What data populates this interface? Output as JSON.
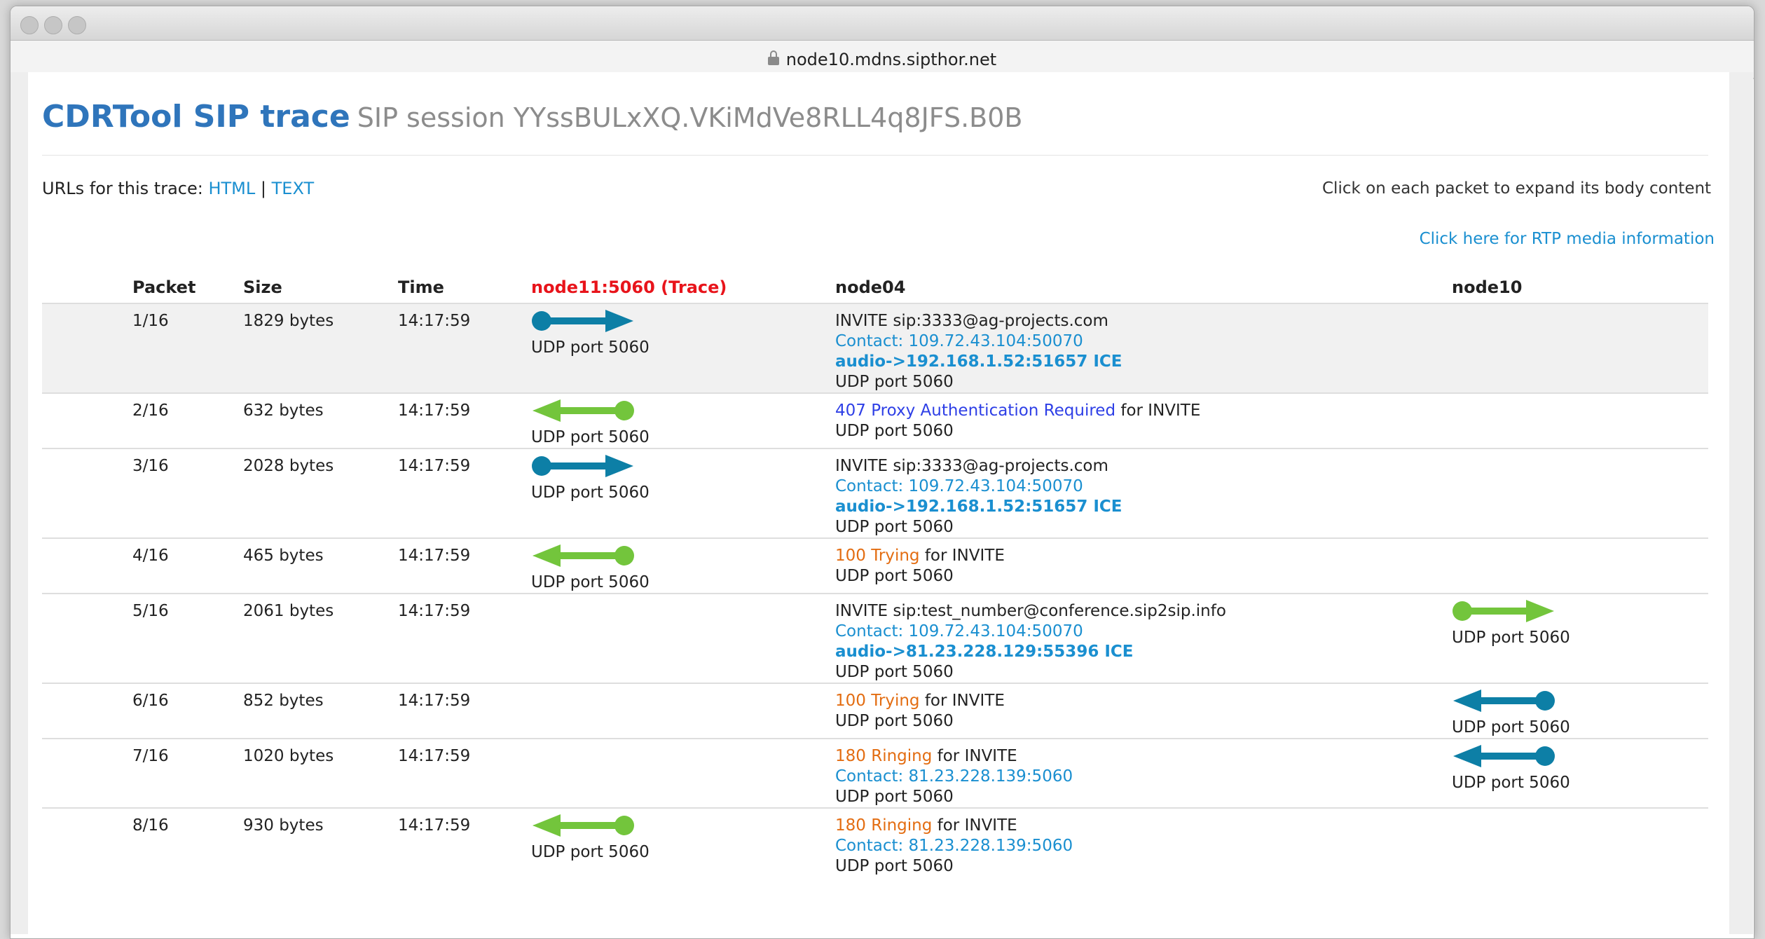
{
  "browser": {
    "url": "node10.mdns.sipthor.net"
  },
  "page": {
    "title_brand": "CDRTool SIP trace",
    "title_session": "SIP session YYssBULxXQ.VKiMdVe8RLL4q8JFS.B0B",
    "urls_label": "URLs for this trace:",
    "url_html": "HTML",
    "url_sep": "|",
    "url_text": "TEXT",
    "help_text": "Click on each packet to expand its body content",
    "rtp_link": "Click here for RTP media information"
  },
  "table": {
    "headers": {
      "packet": "Packet",
      "size": "Size",
      "time": "Time",
      "trace_node": "node11:5060 (Trace)",
      "mid_node": "node04",
      "right_node": "node10"
    },
    "rows": [
      {
        "packet": "1/16",
        "size": "1829 bytes",
        "time": "14:17:59",
        "tone": "normal",
        "left_arrow": {
          "dir": "right",
          "color": "#0d7fa6",
          "port": "UDP port 5060"
        },
        "right_arrow": null,
        "method": "INVITE sip:3333@ag-projects.com",
        "status_text": "",
        "status_suffix": "",
        "contact": "Contact: 109.72.43.104:50070",
        "audio": "audio->192.168.1.52:51657 ICE",
        "via": "UDP port 5060"
      },
      {
        "packet": "2/16",
        "size": "632 bytes",
        "time": "14:17:59",
        "tone": "blue",
        "left_arrow": {
          "dir": "left",
          "color": "#73c53c",
          "port": "UDP port 5060"
        },
        "right_arrow": null,
        "method": "",
        "status_text": "407 Proxy Authentication Required",
        "status_suffix": "for INVITE",
        "contact": "",
        "audio": "",
        "via": "UDP port 5060"
      },
      {
        "packet": "3/16",
        "size": "2028 bytes",
        "time": "14:17:59",
        "tone": "normal",
        "left_arrow": {
          "dir": "right",
          "color": "#0d7fa6",
          "port": "UDP port 5060"
        },
        "right_arrow": null,
        "method": "INVITE sip:3333@ag-projects.com",
        "status_text": "",
        "status_suffix": "",
        "contact": "Contact: 109.72.43.104:50070",
        "audio": "audio->192.168.1.52:51657 ICE",
        "via": "UDP port 5060"
      },
      {
        "packet": "4/16",
        "size": "465 bytes",
        "time": "14:17:59",
        "tone": "orange",
        "left_arrow": {
          "dir": "left",
          "color": "#73c53c",
          "port": "UDP port 5060"
        },
        "right_arrow": null,
        "method": "",
        "status_text": "100 Trying",
        "status_suffix": "for INVITE",
        "contact": "",
        "audio": "",
        "via": "UDP port 5060"
      },
      {
        "packet": "5/16",
        "size": "2061 bytes",
        "time": "14:17:59",
        "tone": "normal",
        "left_arrow": null,
        "right_arrow": {
          "dir": "right",
          "color": "#73c53c",
          "port": "UDP port 5060"
        },
        "method": "INVITE sip:test_number@conference.sip2sip.info",
        "status_text": "",
        "status_suffix": "",
        "contact": "Contact: 109.72.43.104:50070",
        "audio": "audio->81.23.228.129:55396 ICE",
        "via": "UDP port 5060"
      },
      {
        "packet": "6/16",
        "size": "852 bytes",
        "time": "14:17:59",
        "tone": "orange",
        "left_arrow": null,
        "right_arrow": {
          "dir": "left",
          "color": "#0d7fa6",
          "port": "UDP port 5060"
        },
        "method": "",
        "status_text": "100 Trying",
        "status_suffix": "for INVITE",
        "contact": "",
        "audio": "",
        "via": "UDP port 5060"
      },
      {
        "packet": "7/16",
        "size": "1020 bytes",
        "time": "14:17:59",
        "tone": "orange",
        "left_arrow": null,
        "right_arrow": {
          "dir": "left",
          "color": "#0d7fa6",
          "port": "UDP port 5060"
        },
        "method": "",
        "status_text": "180 Ringing",
        "status_suffix": "for INVITE",
        "contact": "Contact: 81.23.228.139:5060",
        "audio": "",
        "via": "UDP port 5060"
      },
      {
        "packet": "8/16",
        "size": "930 bytes",
        "time": "14:17:59",
        "tone": "orange",
        "left_arrow": {
          "dir": "left",
          "color": "#73c53c",
          "port": "UDP port 5060"
        },
        "right_arrow": null,
        "method": "",
        "status_text": "180 Ringing",
        "status_suffix": "for INVITE",
        "contact": "Contact: 81.23.228.139:5060",
        "audio": "",
        "via": "UDP port 5060"
      }
    ]
  }
}
